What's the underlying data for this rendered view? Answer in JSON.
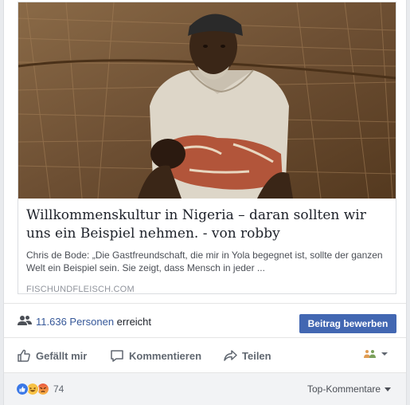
{
  "link_preview": {
    "title": "Willkommenskultur in Nigeria – daran sollten wir uns ein Beispiel nehmen. - von robby",
    "description": "Chris de Bode: „Die Gastfreundschaft, die mir in Yola begegnet ist, sollte der ganzen Welt ein Beispiel sein. Sie zeigt, dass Mensch in jeder ...",
    "domain": "FISCHUNDFLEISCH.COM"
  },
  "reach": {
    "count": "11.636 Personen",
    "suffix": " erreicht",
    "boost_label": "Beitrag bewerben"
  },
  "actions": {
    "like": "Gefällt mir",
    "comment": "Kommentieren",
    "share": "Teilen"
  },
  "comments": {
    "reaction_count": "74",
    "sort_label": "Top-Kommentare"
  },
  "colors": {
    "link": "#365899",
    "button": "#4267b2",
    "action_text": "#606770"
  }
}
